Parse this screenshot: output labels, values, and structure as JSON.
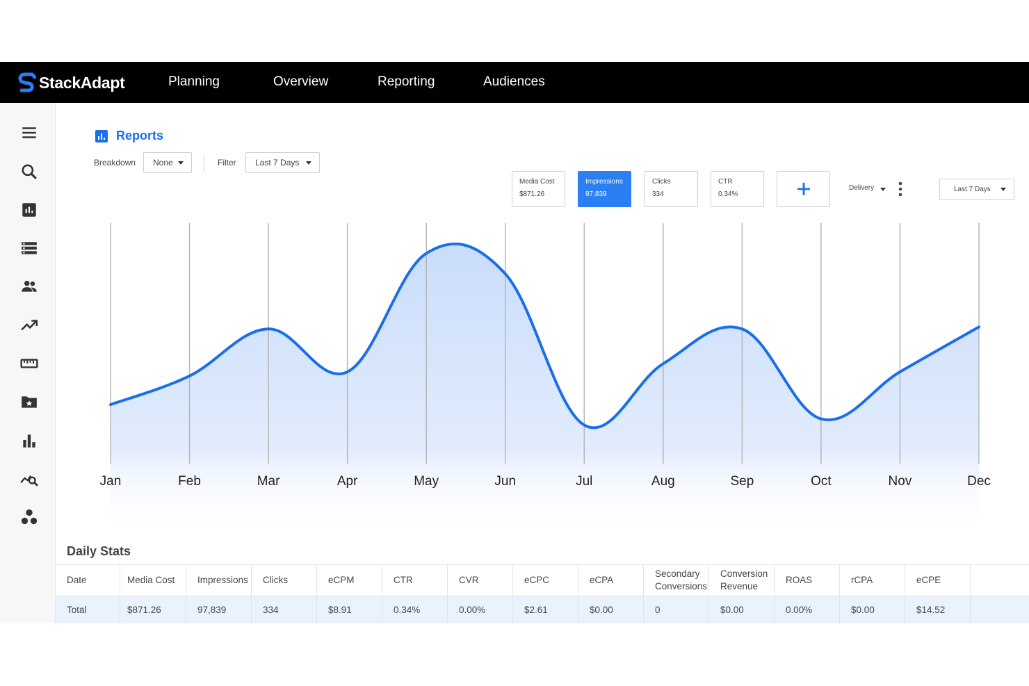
{
  "brand": {
    "name": "StackAdapt",
    "color": "#1a6ee8"
  },
  "nav": {
    "items": [
      "Planning",
      "Overview",
      "Reporting",
      "Audiences"
    ]
  },
  "sidebar": {
    "icons": [
      "menu-icon",
      "search-icon",
      "reports-icon",
      "list-icon",
      "users-icon",
      "trending-icon",
      "ruler-icon",
      "folder-star-icon",
      "bar-chart-icon",
      "analytics-icon",
      "segments-icon"
    ]
  },
  "page": {
    "title": "Reports"
  },
  "controls": {
    "breakdown_label": "Breakdown",
    "breakdown_value": "None",
    "filter_label": "Filter",
    "filter_value": "Last 7 Days",
    "delivery_label": "Delivery",
    "range_value": "Last 7 Days"
  },
  "metrics": [
    {
      "label": "Media Cost",
      "value": "$871.26",
      "active": false
    },
    {
      "label": "Impressions",
      "value": "97,839",
      "active": true
    },
    {
      "label": "Clicks",
      "value": "334",
      "active": false
    },
    {
      "label": "CTR",
      "value": "0.34%",
      "active": false
    }
  ],
  "chart_data": {
    "type": "area",
    "categories": [
      "Jan",
      "Feb",
      "Mar",
      "Apr",
      "May",
      "Jun",
      "Jul",
      "Aug",
      "Sep",
      "Oct",
      "Nov",
      "Dec"
    ],
    "series": [
      {
        "values": [
          18,
          32,
          55,
          34,
          92,
          82,
          8,
          38,
          55,
          11,
          34,
          56
        ]
      }
    ],
    "ylim": [
      0,
      100
    ],
    "grid": "vertical",
    "line_color": "#1a6ee8",
    "fill_color": "#cfe0fb"
  },
  "daily_stats": {
    "title": "Daily Stats",
    "columns": [
      "Date",
      "Media Cost",
      "Impressions",
      "Clicks",
      "eCPM",
      "CTR",
      "CVR",
      "eCPC",
      "eCPA",
      "Secondary Conversions",
      "Conversion Revenue",
      "ROAS",
      "rCPA",
      "eCPE"
    ],
    "rows": [
      [
        "Total",
        "$871.26",
        "97,839",
        "334",
        "$8.91",
        "0.34%",
        "0.00%",
        "$2.61",
        "$0.00",
        "0",
        "$0.00",
        "0.00%",
        "$0.00",
        "$14.52"
      ]
    ]
  }
}
